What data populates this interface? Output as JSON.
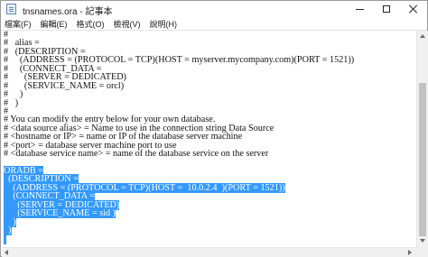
{
  "window": {
    "title": "tnsnames.ora - 記事本"
  },
  "menu": {
    "items": [
      "檔案(F)",
      "編輯(E)",
      "格式(O)",
      "檢視(V)",
      "說明(H)"
    ]
  },
  "editor": {
    "lines": [
      "#",
      "#   alias =",
      "#   (DESCRIPTION =",
      "#     (ADDRESS = (PROTOCOL = TCP)(HOST = myserver.mycompany.com)(PORT = 1521))",
      "#     (CONNECT_DATA =",
      "#       (SERVER = DEDICATED)",
      "#       (SERVICE_NAME = orcl)",
      "#     )",
      "#   )",
      "#",
      "# You can modify the entry below for your own database.",
      "# <data source alias> = Name to use in the connection string Data Source",
      "# <hostname or IP> = name or IP of the database server machine",
      "# <port> = database server machine port to use",
      "# <database service name> = name of the database service on the server",
      "",
      "ORADB =",
      "  (DESCRIPTION =",
      "    (ADDRESS = (PROTOCOL = TCP)(HOST =  10.0.2.4  )(PORT = 1521))",
      "    (CONNECT_DATA =",
      "      (SERVER = DEDICATED)",
      "      (SERVICE_NAME = sid )",
      "    )",
      "  )",
      ""
    ],
    "selected_from_line": 16
  },
  "colors": {
    "selection": "#3399ff",
    "selection_text": "#ffffff"
  }
}
